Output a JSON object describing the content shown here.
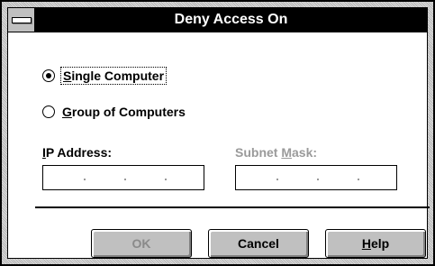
{
  "window": {
    "title": "Deny Access On"
  },
  "mode_options": [
    {
      "label_first": "S",
      "label_rest": "ingle Computer",
      "selected": true
    },
    {
      "label_first": "G",
      "label_rest": "roup of Computers",
      "selected": false
    }
  ],
  "ip_address": {
    "label_first": "I",
    "label_rest": "P Address:",
    "value": ""
  },
  "subnet_mask": {
    "label_before": "Subnet ",
    "label_key": "M",
    "label_after": "ask:",
    "value": ""
  },
  "buttons": {
    "ok": "OK",
    "cancel": "Cancel",
    "help_first": "H",
    "help_rest": "elp"
  },
  "colors": {
    "titlebar": "#000000",
    "disabled_text": "#9a9a9a",
    "button_face": "#c0c0c0"
  }
}
